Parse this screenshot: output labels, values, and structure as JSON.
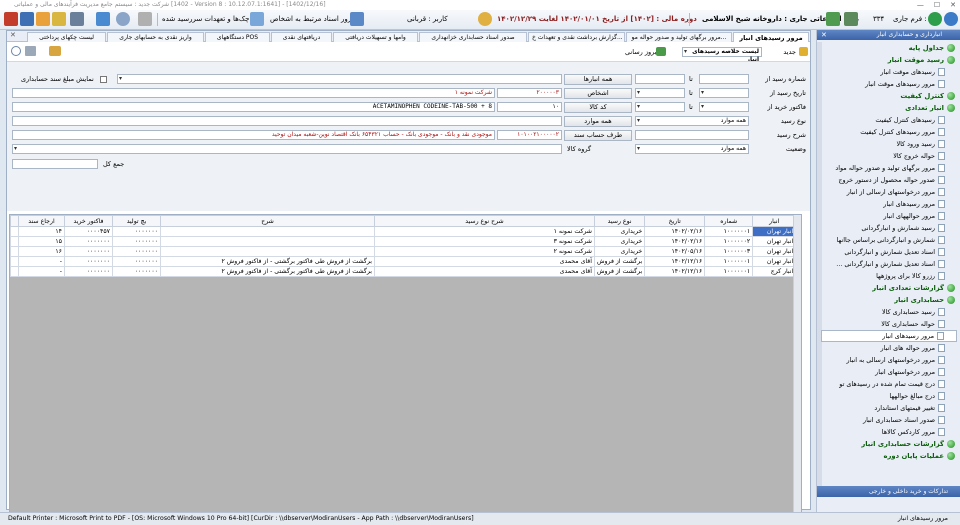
{
  "window": {
    "title": "شرکت جدید : سیستم جامع مدیریت فرآیندهای مالی و عملیاتی [1402 - Version 8 : 10.12.07.1:1641] - [1402/12/16]"
  },
  "toolbar": {
    "form_label": "فرم جاری :",
    "form_value": "۳۳۴",
    "bank_info": "بانک اطلاعاتی جاری : داروخانه شیخ الاسلامی",
    "period": "دوره مالی : [۱۴۰۲] از تاریخ ۱۴۰۲/۰۱/۰۱ لغایت ۱۴۰۲/۱۲/۲۹",
    "user": "کاربر : قربانی",
    "review_docs": "مرور اسناد مرتبط به اشخاص",
    "cheques": "چک‌ها و تعهدات سررسید شده"
  },
  "sidebar": {
    "title": "انبارداری و حسابداری انبار",
    "footer": "تدارکات و خرید داخلی و خارجی",
    "items": [
      {
        "label": "جداول پایه",
        "kind": "head"
      },
      {
        "label": "رسید موقت انبار",
        "kind": "head"
      },
      {
        "label": "رسیدهای موقت انبار",
        "kind": "sub"
      },
      {
        "label": "مرور رسیدهای موقت انبار",
        "kind": "sub"
      },
      {
        "label": "کنترل کیفیت",
        "kind": "head"
      },
      {
        "label": "انبار تعدادی",
        "kind": "head"
      },
      {
        "label": "رسیدهای کنترل کیفیت",
        "kind": "sub"
      },
      {
        "label": "مرور رسیدهای کنترل کیفیت",
        "kind": "sub"
      },
      {
        "label": "رسید ورود کالا",
        "kind": "sub"
      },
      {
        "label": "حواله خروج کالا",
        "kind": "sub"
      },
      {
        "label": "مرور برگهای تولید و صدور حواله مواد",
        "kind": "sub"
      },
      {
        "label": "صدور حواله محصول از دستور خروج",
        "kind": "sub"
      },
      {
        "label": "مرور درخواستهای ارسالی از انبار",
        "kind": "sub"
      },
      {
        "label": "مرور رسیدهای انبار",
        "kind": "sub"
      },
      {
        "label": "مرور حوالههای انبار",
        "kind": "sub"
      },
      {
        "label": "رسید شمارش و انبارگردانی",
        "kind": "sub"
      },
      {
        "label": "شمارش و انبارگردانی براساس جاانها",
        "kind": "sub"
      },
      {
        "label": "اسناد تعدیل شمارش و انبارگردانی",
        "kind": "sub"
      },
      {
        "label": "اسناد تعدیل شمارش و انبارگردانی ...",
        "kind": "sub"
      },
      {
        "label": "رزرو کالا برای پروژهها",
        "kind": "sub"
      },
      {
        "label": "گزارشات تعدادی انبار",
        "kind": "head"
      },
      {
        "label": "حسابداری انبار",
        "kind": "head"
      },
      {
        "label": "رسید حسابداری کالا",
        "kind": "sub"
      },
      {
        "label": "حواله حسابداری کالا",
        "kind": "sub"
      },
      {
        "label": "مرور رسیدهای انبار",
        "kind": "sub",
        "selected": true
      },
      {
        "label": "مرور حواله های انبار",
        "kind": "sub"
      },
      {
        "label": "مرور درخواستهای ارسالی به انبار",
        "kind": "sub"
      },
      {
        "label": "مرور درخواستهای انبار",
        "kind": "sub"
      },
      {
        "label": "درج قیمت تمام شده در رسیدهای تو",
        "kind": "sub"
      },
      {
        "label": "درج مبالغ حوالهها",
        "kind": "sub"
      },
      {
        "label": "تغییر قیمتهای استاندارد",
        "kind": "sub"
      },
      {
        "label": "صدور اسناد حسابداری انبار",
        "kind": "sub"
      },
      {
        "label": "مرور کاردکس کالاها",
        "kind": "sub"
      },
      {
        "label": "گزارشات حسابداری انبار",
        "kind": "head"
      },
      {
        "label": "عملیات پایان دوره",
        "kind": "head"
      }
    ]
  },
  "tabs": [
    {
      "label": "مرور رسیدهای انبار",
      "active": true
    },
    {
      "label": "مرور برگهای تولید و صدور حواله مو..."
    },
    {
      "label": "گزارش برداشت نقدی و تعهدات خ..."
    },
    {
      "label": "صدور اسناد حسابداری خزانهداری"
    },
    {
      "label": "وامها و تسهیلات دریافتی"
    },
    {
      "label": "دریافتهای نقدی"
    },
    {
      "label": "دستگاههای POS"
    },
    {
      "label": "واریز نقدی به حسابهای جاری"
    },
    {
      "label": "لیست چکهای پرداختی"
    }
  ],
  "actions": {
    "new": "جدید",
    "report_select": "لیست خلاصه رسیدهای انبار",
    "refresh": "بروز رسانی"
  },
  "form": {
    "receipt_no_label": "شماره رسید از",
    "receipt_date_label": "تاریخ رسید از",
    "invoice_label": "فاکتور خرید از",
    "receipt_type_label": "نوع رسید",
    "desc_label": "شرح رسید",
    "status_label": "وضعیت",
    "to_label": "تا",
    "warehouses_btn": "همه انبارها",
    "persons_btn": "اشخاص",
    "goods_code_btn": "کد کالا",
    "all_items_btn": "همه موارد",
    "account_btn": "طرف حساب سند",
    "goods_group_label": "گروه کالا",
    "receipt_type_value": "همه موارد",
    "status_value": "همه موارد",
    "person_code": "۲۰۰۰۰۰۳",
    "person_name": "شرکت نمونه ۱",
    "goods_code": "۱۰",
    "goods_name": "ACETAMINOPHEN CODEINE-TAB-500 + 8",
    "account_code": "۱۰۱۰۰۲۱۰۰۰۰۰۲",
    "account_name": "موجودی نقد و بانک - موجودی بانک - حساب ۶۵۴۳۲۱ بانک اقتصاد نوین-شعبه میدان توحید",
    "show_amount_label": "نمایش مبلغ سند حسابداری",
    "total_label": "جمع کل"
  },
  "grid": {
    "columns": [
      "انبار",
      "شماره",
      "تاریخ",
      "نوع رسید",
      "شرح نوع رسید",
      "شرح",
      "بچ تولید",
      "فاکتور خرید",
      "ارجاع سند"
    ],
    "rows": [
      [
        "انبار تهران",
        "۱۰۰۰۰۰۰۱",
        "۱۴۰۲/۰۲/۱۶",
        "خریداری",
        "شرکت نمونه ۱",
        "",
        "۰۰۰۰۰۰۰",
        "۰۰۰۰۴۵۷",
        "۱۴"
      ],
      [
        "انبار تهران",
        "۱۰۰۰۰۰۰۲",
        "۱۴۰۲/۰۲/۱۶",
        "خریداری",
        "شرکت نمونه ۳",
        "",
        "۰۰۰۰۰۰۰",
        "۰۰۰۰۰۰۰",
        "۱۵"
      ],
      [
        "انبار تهران",
        "۱۰۰۰۰۰۰۳",
        "۱۴۰۲/۰۵/۱۶",
        "خریداری",
        "شرکت نمونه ۲",
        "",
        "۰۰۰۰۰۰۰",
        "۰۰۰۰۰۰۰",
        "۱۶"
      ],
      [
        "انبار تهران",
        "۱۰۰۰۰۰۰۱",
        "۱۴۰۲/۱۲/۱۶",
        "برگشت از فروش",
        "آقای محمدی",
        "برگشت از فروش طی فاکتور برگشتی - از فاکتور فروش ۲",
        "۰۰۰۰۰۰۰",
        "۰۰۰۰۰۰۰",
        "-"
      ],
      [
        "انبار کرج",
        "۱۰۰۰۰۰۰۱",
        "۱۴۰۲/۱۲/۱۶",
        "برگشت از فروش",
        "آقای محمدی",
        "برگشت از فروش طی فاکتور برگشتی - از فاکتور فروش ۲",
        "۰۰۰۰۰۰۰",
        "۰۰۰۰۰۰۰",
        "-"
      ]
    ]
  },
  "status": {
    "left": "Default Printer : Microsoft Print to PDF - [OS: Microsoft Windows 10 Pro 64-bit]  [CurDir : \\\\dbserver\\ModiranUsers - App Path : \\\\dbserver\\ModiranUsers]",
    "right": "مرور رسیدهای انبار"
  }
}
